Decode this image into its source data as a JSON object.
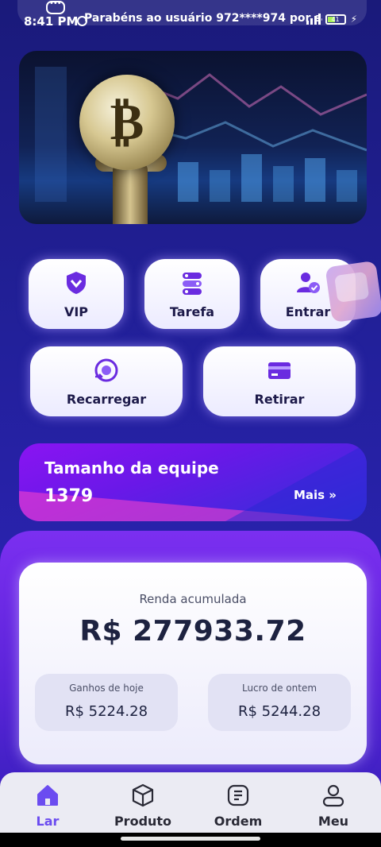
{
  "status_bar": {
    "time": "8:41 PM",
    "notice": "Parabéns ao usuário 972****974 por sacar",
    "battery_level": "41"
  },
  "banner": {
    "image": "bitcoin-coin-on-stand-photo"
  },
  "quick_actions": {
    "vip": "VIP",
    "tarefa": "Tarefa",
    "entrar": "Entrar",
    "recarregar": "Recarregar",
    "retirar": "Retirar"
  },
  "team": {
    "title": "Tamanho da equipe",
    "count": "1379",
    "more": "Mais"
  },
  "stats": {
    "total_label": "Renda acumulada",
    "total_value": "R$ 277933.72",
    "today_label": "Ganhos de hoje",
    "today_value": "R$ 5224.28",
    "yesterday_label": "Lucro de ontem",
    "yesterday_value": "R$ 5244.28"
  },
  "nav": {
    "home": "Lar",
    "product": "Produto",
    "order": "Ordem",
    "me": "Meu",
    "active": "home"
  },
  "colors": {
    "accent": "#6b4cf0",
    "background": "#22209a",
    "text_dark": "#1d2240"
  }
}
